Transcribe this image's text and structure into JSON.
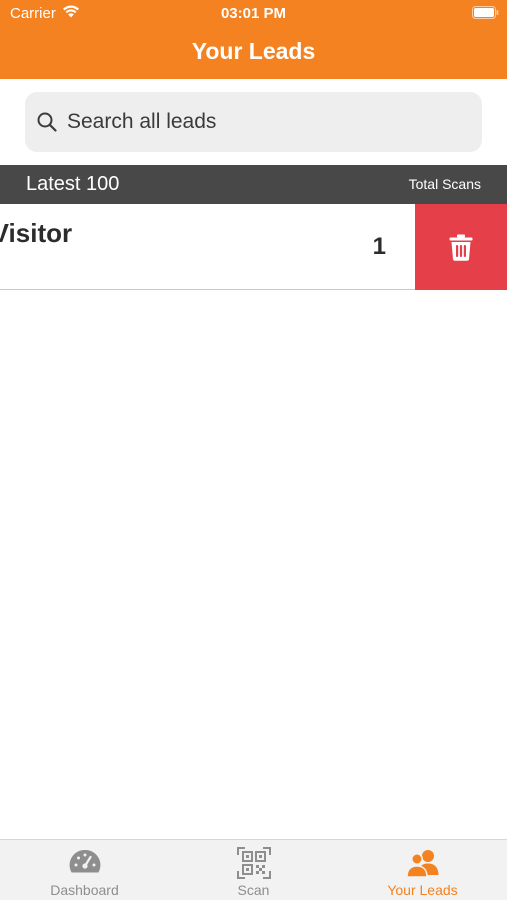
{
  "colors": {
    "accent": "#F58220",
    "section_bg": "#484848",
    "delete": "#E5404A",
    "tab_inactive": "#8e8e8e"
  },
  "status_bar": {
    "carrier": "Carrier",
    "time": "03:01 PM"
  },
  "nav": {
    "title": "Your Leads"
  },
  "search": {
    "placeholder": "Search all leads"
  },
  "section": {
    "title": "Latest 100",
    "right_label": "Total Scans"
  },
  "leads": [
    {
      "name": "e Visitor",
      "count": "1",
      "action_icon": "trash-icon"
    }
  ],
  "tabs": [
    {
      "label": "Dashboard",
      "icon": "speedometer-icon",
      "active": false
    },
    {
      "label": "Scan",
      "icon": "qr-code-icon",
      "active": false
    },
    {
      "label": "Your Leads",
      "icon": "people-icon",
      "active": true
    }
  ]
}
